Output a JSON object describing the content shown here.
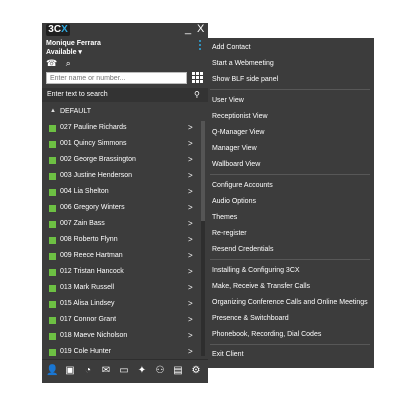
{
  "app": {
    "logo": "3C",
    "logo_accent": "X",
    "minimize": "_",
    "close": "X",
    "user_name": "Monique Ferrara",
    "status": "Available ▾"
  },
  "dialer": {
    "placeholder": "Enter name or number..."
  },
  "search": {
    "placeholder": "Enter text to search"
  },
  "group": {
    "arrow": "▲",
    "label": "DEFAULT"
  },
  "contacts": [
    {
      "name": "027 Pauline Richards"
    },
    {
      "name": "001 Quincy Simmons"
    },
    {
      "name": "002 George Brassington"
    },
    {
      "name": "003 Justine Henderson"
    },
    {
      "name": "004 Lia Shelton"
    },
    {
      "name": "006 Gregory Winters"
    },
    {
      "name": "007 Zain Bass"
    },
    {
      "name": "008 Roberto Flynn"
    },
    {
      "name": "009 Reece Hartman"
    },
    {
      "name": "012 Tristan Hancock"
    },
    {
      "name": "013 Mark Russell"
    },
    {
      "name": "015 Alisa Lindsey"
    },
    {
      "name": "017 Connor Grant"
    },
    {
      "name": "018 Maeve Nicholson"
    },
    {
      "name": "019 Cole Hunter"
    }
  ],
  "contact_chevron": ">",
  "menu": {
    "add_contact": "Add Contact",
    "start_webmeeting": "Start a Webmeeting",
    "show_blf": "Show BLF side panel",
    "user_view": "User View",
    "receptionist_view": "Receptionist View",
    "qmanager_view": "Q-Manager View",
    "manager_view": "Manager View",
    "wallboard_view": "Wallboard View",
    "configure_accounts": "Configure Accounts",
    "audio_options": "Audio Options",
    "themes": "Themes",
    "reregister": "Re-register",
    "resend_credentials": "Resend Credentials",
    "installing": "Installing & Configuring 3CX",
    "make_receive": "Make, Receive & Transfer Calls",
    "organizing": "Organizing Conference Calls and Online Meetings",
    "presence": "Presence & Switchboard",
    "phonebook": "Phonebook, Recording, Dial Codes",
    "exit": "Exit Client"
  },
  "icons": {
    "phone": "☎",
    "search": "⌕",
    "search_small": "⚲",
    "person_add": "👤",
    "contact_card": "▣",
    "history": "◔",
    "voicemail": "✉",
    "chat": "▭",
    "presence": "✦",
    "conference": "⚇",
    "switchboard": "▤",
    "settings": "⚙"
  },
  "colors": {
    "panel": "#3c3c3c",
    "presence_available": "#6dc043",
    "accent": "#2fa9e0"
  }
}
